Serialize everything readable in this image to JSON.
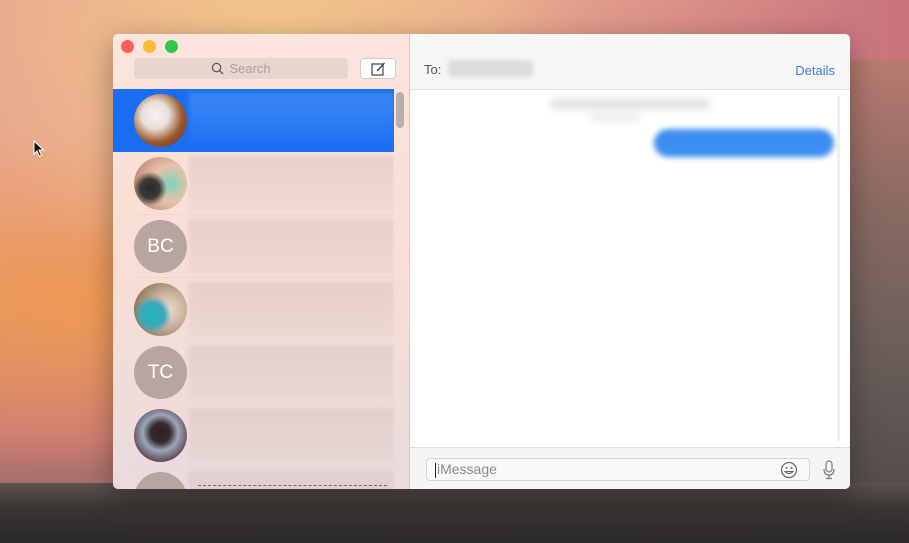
{
  "window": {
    "traffic_lights": [
      "close",
      "minimize",
      "maximize"
    ]
  },
  "sidebar": {
    "search_placeholder": "Search",
    "search_icon": "magnifier-icon",
    "compose_icon": "compose-icon",
    "conversations": [
      {
        "avatar_type": "photo",
        "initials": "",
        "selected": true
      },
      {
        "avatar_type": "photo",
        "initials": "",
        "selected": false
      },
      {
        "avatar_type": "initials",
        "initials": "BC",
        "selected": false
      },
      {
        "avatar_type": "photo",
        "initials": "",
        "selected": false
      },
      {
        "avatar_type": "initials",
        "initials": "TC",
        "selected": false
      },
      {
        "avatar_type": "photo",
        "initials": "",
        "selected": false
      },
      {
        "avatar_type": "photo",
        "initials": "",
        "selected": false
      }
    ]
  },
  "header": {
    "to_label": "To:",
    "details_label": "Details"
  },
  "composer": {
    "placeholder": "iMessage",
    "emoji_icon": "emoji-icon",
    "mic_icon": "microphone-icon"
  },
  "colors": {
    "selection": "#1a6ef2",
    "link": "#3b82d6",
    "bubble": "#3d8ef2"
  }
}
